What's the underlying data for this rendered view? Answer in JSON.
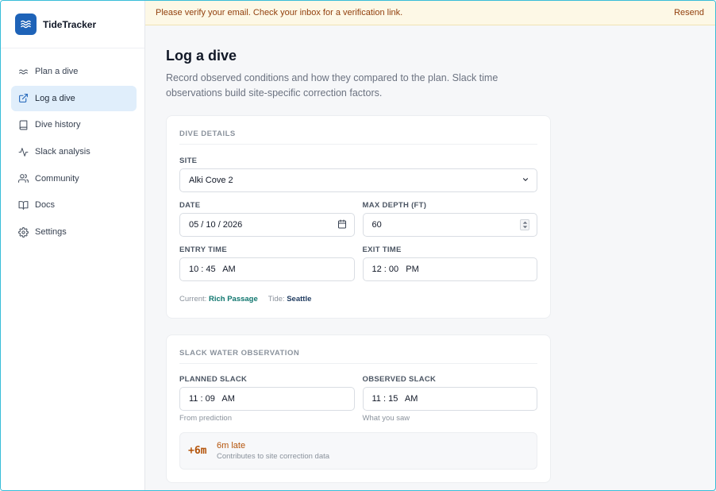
{
  "app": {
    "name": "TideTracker"
  },
  "sidebar": {
    "items": [
      {
        "label": "Plan a dive",
        "icon": "waves-icon"
      },
      {
        "label": "Log a dive",
        "icon": "external-link-icon",
        "active": true
      },
      {
        "label": "Dive history",
        "icon": "book-icon"
      },
      {
        "label": "Slack analysis",
        "icon": "activity-icon"
      },
      {
        "label": "Community",
        "icon": "users-icon"
      },
      {
        "label": "Docs",
        "icon": "book-open-icon"
      },
      {
        "label": "Settings",
        "icon": "gear-icon"
      }
    ]
  },
  "banner": {
    "message": "Please verify your email. Check your inbox for a verification link.",
    "action": "Resend"
  },
  "page": {
    "title": "Log a dive",
    "subtitle": "Record observed conditions and how they compared to the plan. Slack time observations build site-specific correction factors."
  },
  "details": {
    "title": "DIVE DETAILS",
    "site_label": "SITE",
    "site_value": "Alki Cove 2",
    "date_label": "DATE",
    "date_value": "05 / 10 / 2026",
    "depth_label": "MAX DEPTH (FT)",
    "depth_value": "60",
    "entry_label": "ENTRY TIME",
    "entry_value": "10 : 45   AM",
    "exit_label": "EXIT TIME",
    "exit_value": "12 : 00   PM",
    "current_label": "Current:",
    "current_value": "Rich Passage",
    "tide_label": "Tide:",
    "tide_value": "Seattle"
  },
  "slack": {
    "title": "SLACK WATER OBSERVATION",
    "planned_label": "PLANNED SLACK",
    "planned_value": "11 : 09   AM",
    "planned_hint": "From prediction",
    "observed_label": "OBSERVED SLACK",
    "observed_value": "11 : 15   AM",
    "observed_hint": "What you saw",
    "delta": "+6m",
    "result_main": "6m late",
    "result_sub": "Contributes to site correction data"
  },
  "colors": {
    "brand": "#1e63b8",
    "active_nav": "#e0eefb",
    "warning_text": "#92400e",
    "late": "#b45309",
    "teal": "#0f766e"
  }
}
